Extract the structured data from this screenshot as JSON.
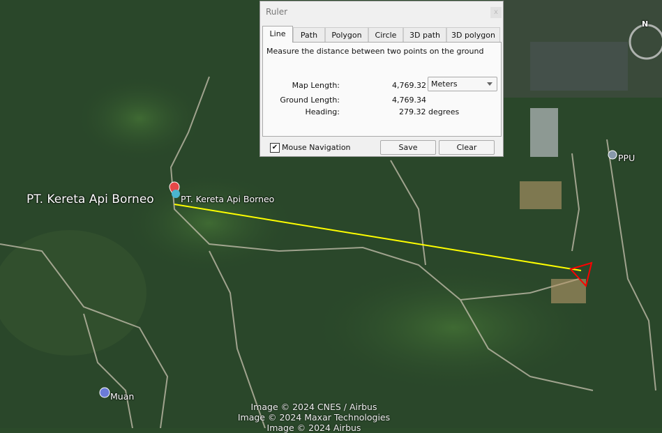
{
  "map": {
    "labels": {
      "large_place": "PT. Kereta Api Borneo",
      "pin_place": "PT. Kereta Api Borneo",
      "ppu": "PPU",
      "muan": "Muan"
    },
    "compass_letter": "N",
    "credits": [
      "Image © 2024 CNES / Airbus",
      "Image © 2024 Maxar Technologies",
      "Image © 2024 Airbus"
    ],
    "measure_line_color": "#ffff00",
    "end_marker_color": "#ff0000"
  },
  "ruler": {
    "title": "Ruler",
    "close": "x",
    "tabs": [
      {
        "label": "Line",
        "active": true
      },
      {
        "label": "Path"
      },
      {
        "label": "Polygon"
      },
      {
        "label": "Circle"
      },
      {
        "label": "3D path"
      },
      {
        "label": "3D polygon"
      }
    ],
    "description": "Measure the distance between two points on the ground",
    "map_length_label": "Map Length:",
    "map_length_value": "4,769.32",
    "unit": "Meters",
    "ground_length_label": "Ground Length:",
    "ground_length_value": "4,769.34",
    "heading_label": "Heading:",
    "heading_value": "279.32 degrees",
    "mouse_navigation_label": "Mouse Navigation",
    "mouse_navigation_checked": true,
    "check_mark": "✔",
    "save_label": "Save",
    "clear_label": "Clear"
  }
}
